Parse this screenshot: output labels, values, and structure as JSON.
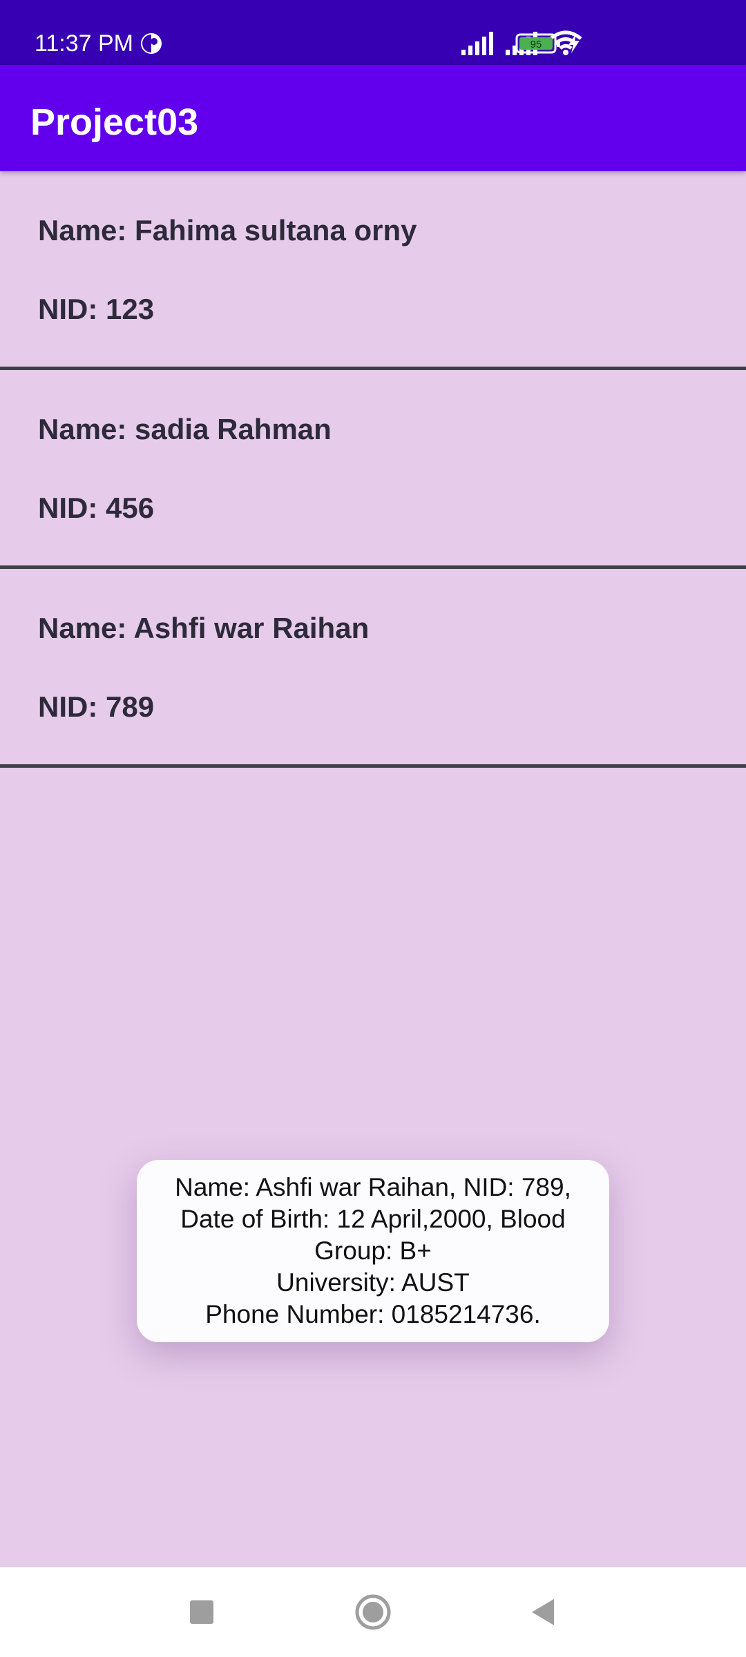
{
  "status_bar": {
    "time": "11:37 PM",
    "battery_level": "95"
  },
  "app_bar": {
    "title": "Project03"
  },
  "list": [
    {
      "name": "Name: Fahima sultana orny",
      "nid": "NID: 123"
    },
    {
      "name": "Name: sadia Rahman",
      "nid": "NID: 456"
    },
    {
      "name": "Name: Ashfi war Raihan",
      "nid": "NID: 789"
    }
  ],
  "toast": {
    "text": "Name: Ashfi war Raihan, NID: 789,\nDate of Birth: 12 April,2000, Blood\nGroup: B+\nUniversity: AUST\nPhone Number: 0185214736."
  },
  "navigation": {
    "icons": [
      "recent-apps-icon",
      "home-icon",
      "back-icon"
    ]
  },
  "colors": {
    "status_bar": "#3700b3",
    "app_bar": "#6200ee",
    "background": "#e6cbea",
    "divider": "#3f3f46"
  }
}
